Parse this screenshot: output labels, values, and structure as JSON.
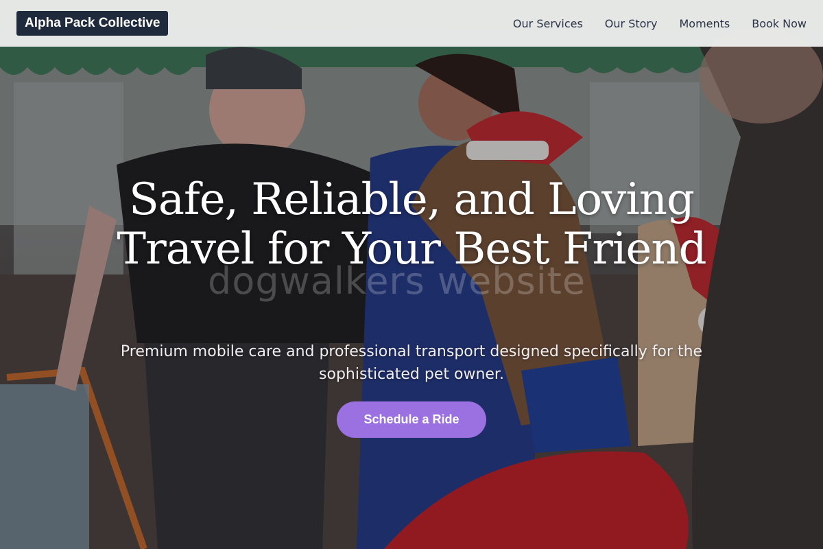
{
  "header": {
    "logo_text": "Alpha Pack Collective",
    "nav": [
      {
        "label": "Our Services"
      },
      {
        "label": "Our Story"
      },
      {
        "label": "Moments"
      },
      {
        "label": "Book Now"
      }
    ]
  },
  "hero": {
    "headline": "Safe, Reliable, and Loving Travel for Your Best Friend",
    "subheadline": "Premium mobile care and professional transport designed specifically for the sophisticated pet owner.",
    "cta_label": "Schedule a Ride",
    "watermark": "dogwalkers website",
    "photo_description_icon": "hero-photo"
  },
  "colors": {
    "accent": "#9b70e0",
    "logo_bg": "#1f2a3c",
    "nav_text": "#2c3548",
    "header_bg": "#f0f2f0"
  }
}
